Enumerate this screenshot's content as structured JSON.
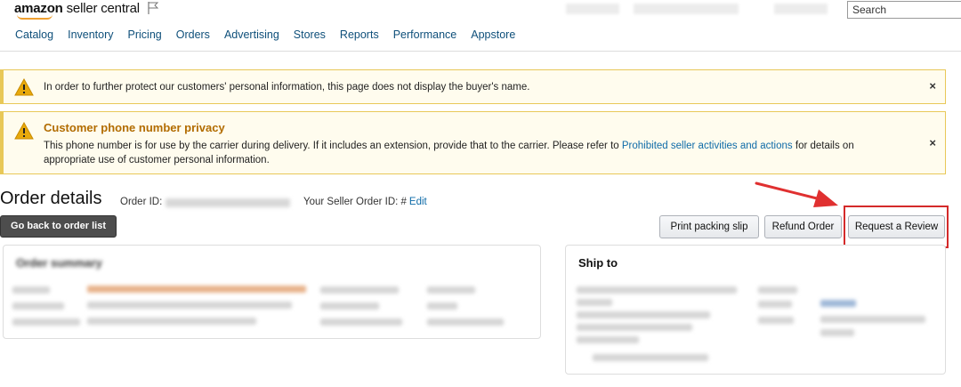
{
  "header": {
    "logo_brand": "amazon",
    "logo_product": "seller central",
    "search_placeholder": "Search",
    "nav": [
      "Catalog",
      "Inventory",
      "Pricing",
      "Orders",
      "Advertising",
      "Stores",
      "Reports",
      "Performance",
      "Appstore"
    ]
  },
  "alerts": {
    "buyer_name_notice": "In order to further protect our customers' personal information, this page does not display the buyer's name.",
    "phone_privacy_title": "Customer phone number privacy",
    "phone_privacy_text": "This phone number is for use by the carrier during delivery. If it includes an extension, provide that to the carrier. Please refer to",
    "phone_privacy_link": "Prohibited seller activities and actions",
    "phone_privacy_text_end": "for details on appropriate use of customer personal information.",
    "close_label": "×"
  },
  "order": {
    "title": "Order details",
    "order_id_label": "Order ID:",
    "seller_order_label": "Your Seller Order ID: #",
    "edit_label": "Edit",
    "back_button": "Go back to order list"
  },
  "actions": {
    "print": "Print packing slip",
    "refund": "Refund Order",
    "review": "Request a Review"
  },
  "panels": {
    "summary_title": "Order summary",
    "ship_title": "Ship to"
  },
  "colors": {
    "alert_border": "#e8c858",
    "alert_bg": "#fffcee",
    "highlight": "#d42a2a",
    "link": "#0e6ba8"
  }
}
